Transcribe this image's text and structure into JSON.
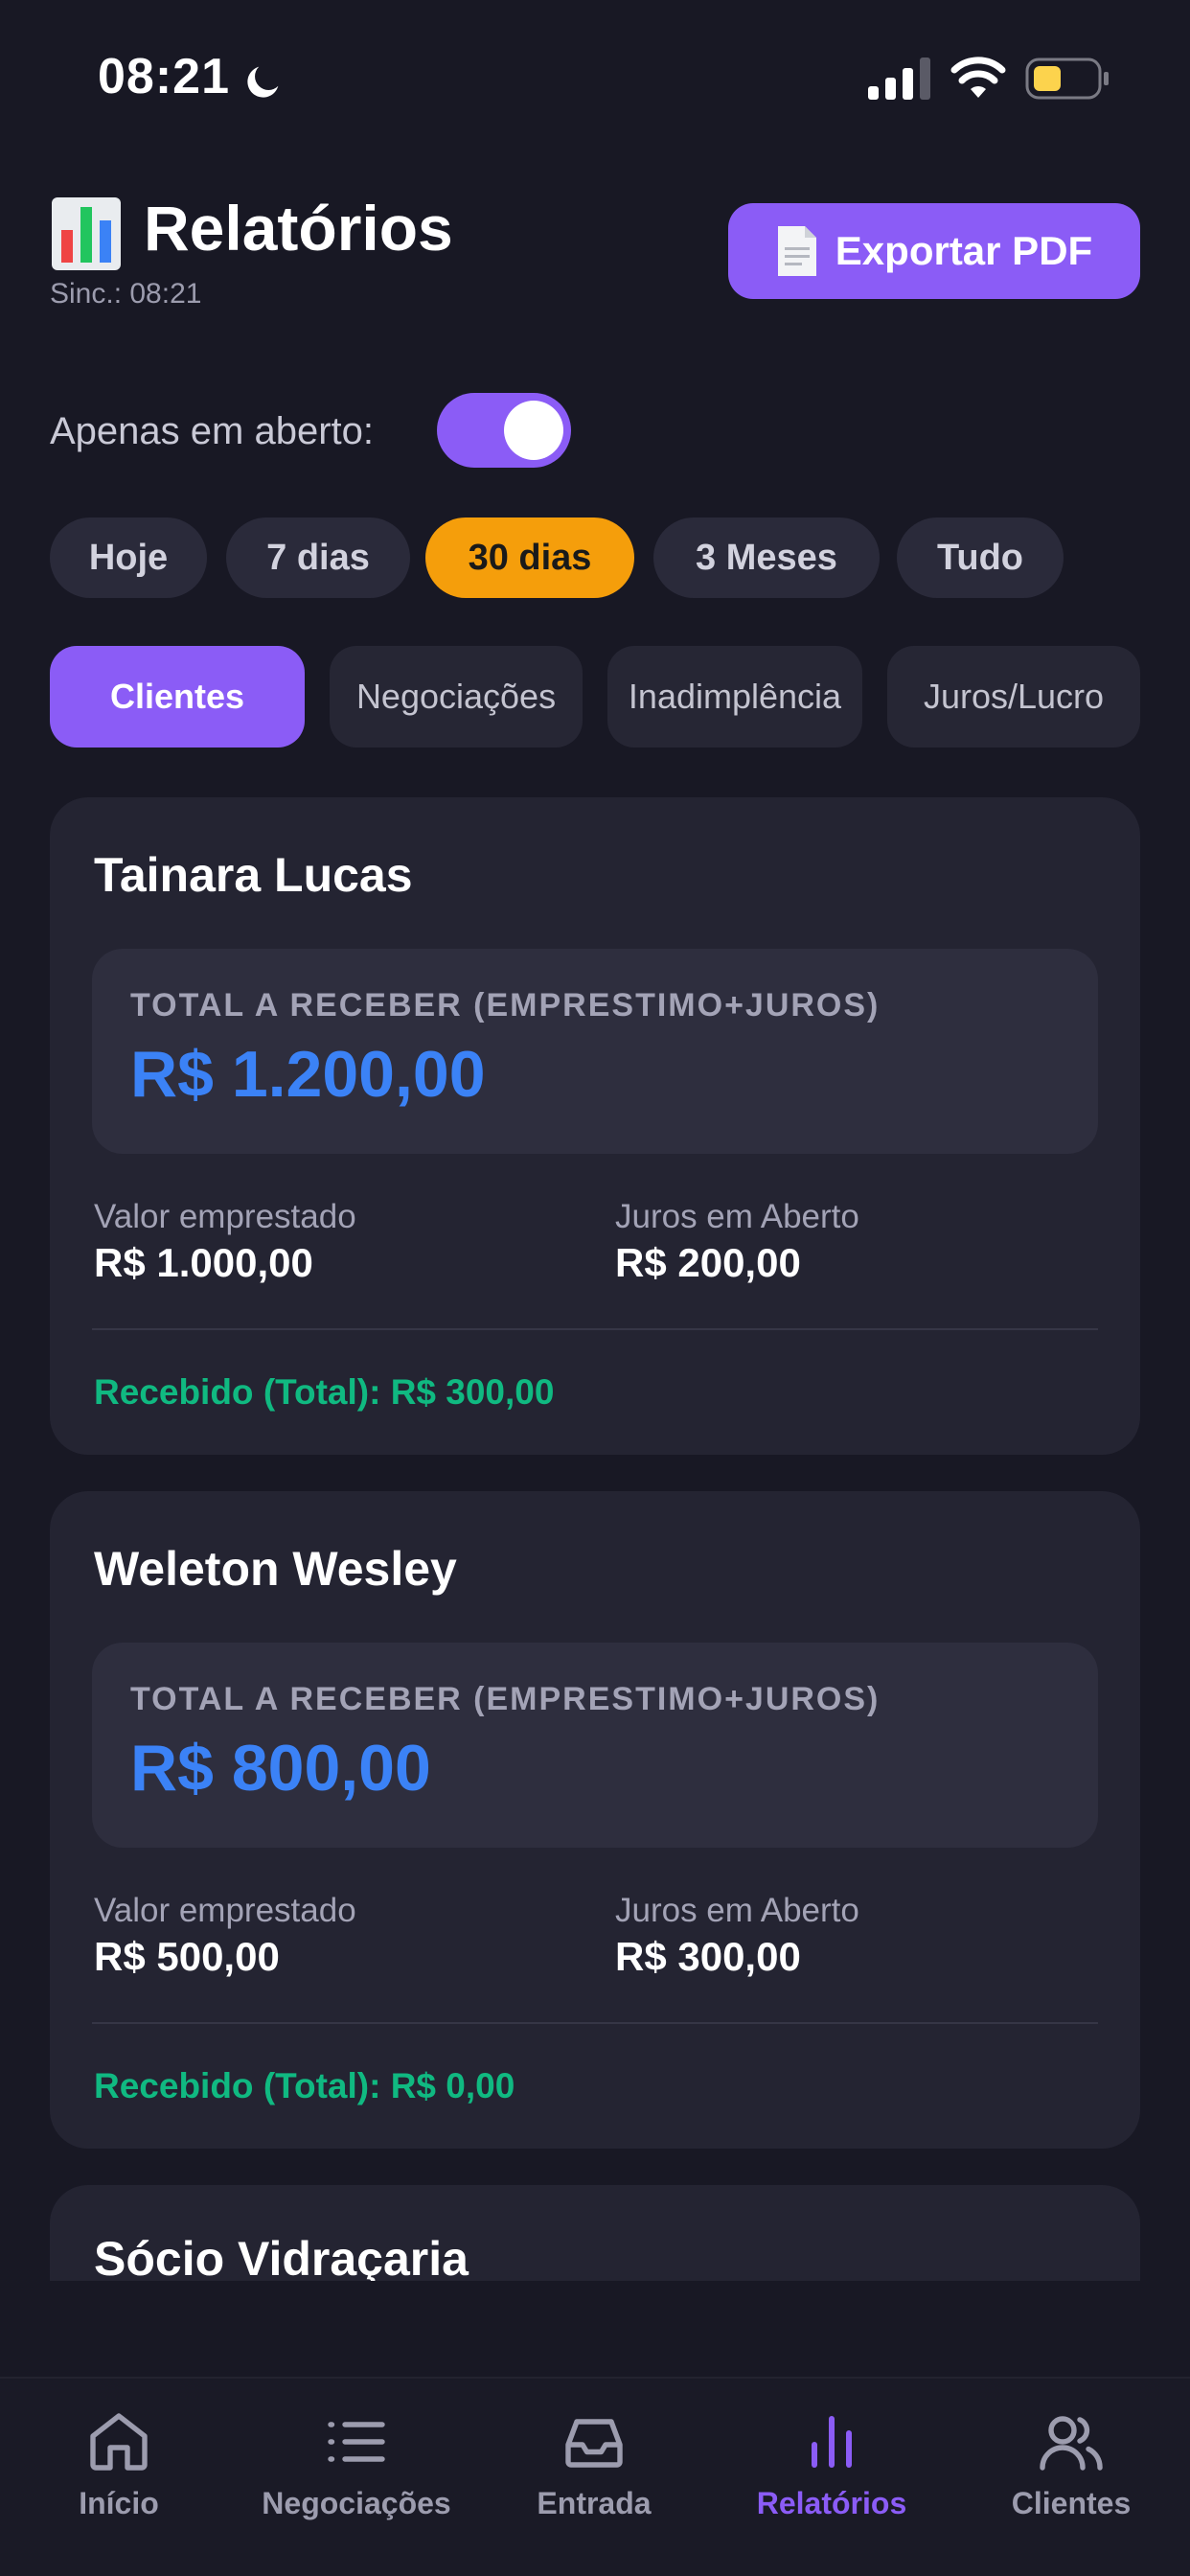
{
  "status_bar": {
    "time": "08:21"
  },
  "header": {
    "title": "Relatórios",
    "sync": "Sinc.: 08:21",
    "export_label": "Exportar PDF"
  },
  "filter": {
    "open_only_label": "Apenas em aberto:",
    "open_only_on": true
  },
  "periods": [
    "Hoje",
    "7 dias",
    "30 dias",
    "3 Meses",
    "Tudo"
  ],
  "active_period": "30 dias",
  "tabs": [
    "Clientes",
    "Negociações",
    "Inadimplência",
    "Juros/Lucro"
  ],
  "active_tab": "Clientes",
  "cards": [
    {
      "name": "Tainara Lucas",
      "total_label": "TOTAL A RECEBER (EMPRESTIMO+JUROS)",
      "total_value": "R$ 1.200,00",
      "lent_label": "Valor emprestado",
      "lent_value": "R$ 1.000,00",
      "interest_label": "Juros em Aberto",
      "interest_value": "R$ 200,00",
      "received": "Recebido (Total): R$ 300,00"
    },
    {
      "name": "Weleton Wesley",
      "total_label": "TOTAL A RECEBER (EMPRESTIMO+JUROS)",
      "total_value": "R$ 800,00",
      "lent_label": "Valor emprestado",
      "lent_value": "R$ 500,00",
      "interest_label": "Juros em Aberto",
      "interest_value": "R$ 300,00",
      "received": "Recebido (Total): R$ 0,00"
    },
    {
      "name": "Sócio Vidraçaria"
    }
  ],
  "nav": [
    "Início",
    "Negociações",
    "Entrada",
    "Relatórios",
    "Clientes"
  ],
  "active_nav": "Relatórios",
  "colors": {
    "accent": "#8b5cf6",
    "period_active": "#f59e0b",
    "total_value": "#3b82f6",
    "received": "#10b981",
    "background": "#181824"
  }
}
